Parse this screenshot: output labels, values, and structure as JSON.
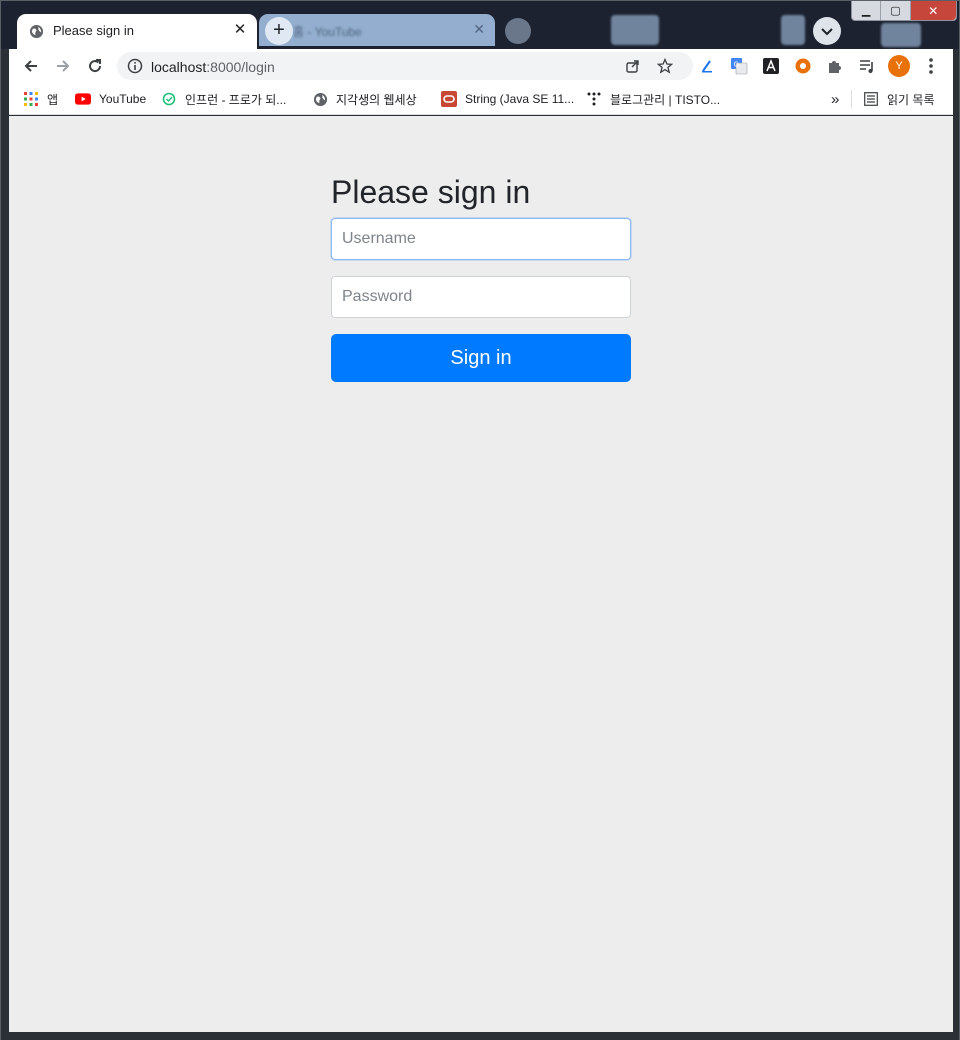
{
  "browser": {
    "active_tab": {
      "title": "Please sign in",
      "close_glyph": "✕"
    },
    "inactive_tab": {
      "title": "홈 - YouTube",
      "close_glyph": "✕"
    },
    "new_tab_glyph": "+",
    "url": {
      "host": "localhost",
      "rest": ":8000/login"
    },
    "profile_initial": "Y",
    "window_controls": {
      "minimize": "▁",
      "maximize": "▢",
      "close": "✕"
    }
  },
  "bookmarks": {
    "items": [
      {
        "label": "앱",
        "icon": "apps-grid-icon"
      },
      {
        "label": "YouTube",
        "icon": "youtube-icon"
      },
      {
        "label": "인프런 - 프로가 되...",
        "icon": "inflearn-icon"
      },
      {
        "label": "지각생의 웹세상",
        "icon": "globe-icon"
      },
      {
        "label": "String (Java SE 11...",
        "icon": "oracle-icon"
      },
      {
        "label": "블로그관리 | TISTO...",
        "icon": "tistory-icon"
      }
    ],
    "overflow_glyph": "»",
    "reading_list_label": "읽기 목록"
  },
  "form": {
    "heading": "Please sign in",
    "username_placeholder": "Username",
    "password_placeholder": "Password",
    "submit_label": "Sign in"
  },
  "colors": {
    "primary_button": "#007bff",
    "page_background": "#ededed",
    "avatar": "#e8710a"
  }
}
